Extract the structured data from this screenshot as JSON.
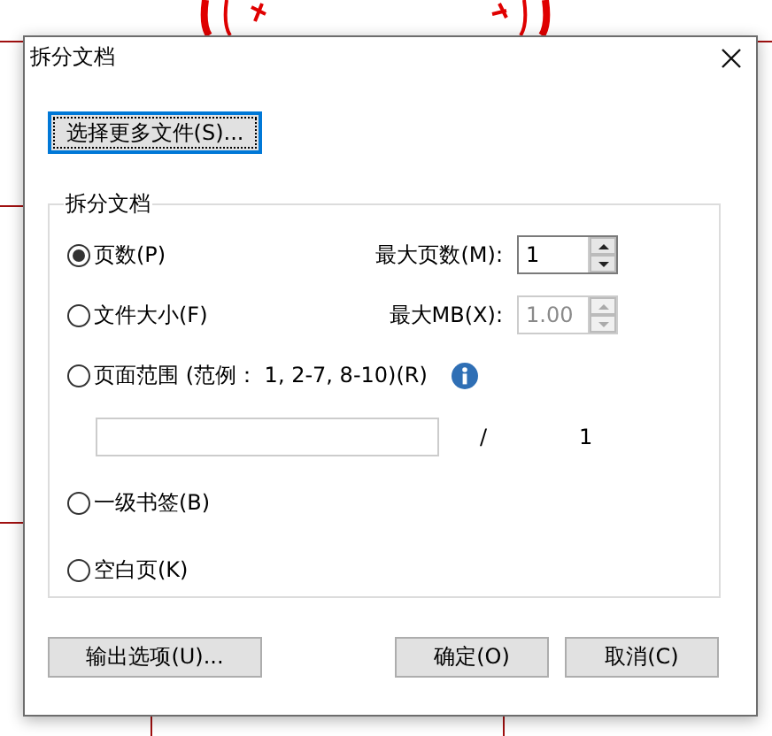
{
  "window": {
    "title": "拆分文档"
  },
  "select_files_button": {
    "label": "选择更多文件(S)...",
    "focused": true
  },
  "group": {
    "title": "拆分文档",
    "options": [
      {
        "kind": "spin",
        "label": "页数(P)",
        "selected": true,
        "field_label": "最大页数(M):",
        "value": "1",
        "disabled": false
      },
      {
        "kind": "spin",
        "label": "文件大小(F)",
        "selected": false,
        "field_label": "最大MB(X):",
        "value": "1.00",
        "disabled": true
      },
      {
        "kind": "range",
        "label": "页面范围 (范例： 1, 2-7, 8-10)(R)",
        "selected": false,
        "separator": "/",
        "total": "1"
      },
      {
        "kind": "plain",
        "label": "一级书签(B)",
        "selected": false
      },
      {
        "kind": "plain",
        "label": "空白页(K)",
        "selected": false
      }
    ]
  },
  "buttons": [
    {
      "label": "输出选项(U)...",
      "kind": "left"
    },
    {
      "label": "确定(O)",
      "kind": "right"
    },
    {
      "label": "取消(C)",
      "kind": "right"
    }
  ]
}
